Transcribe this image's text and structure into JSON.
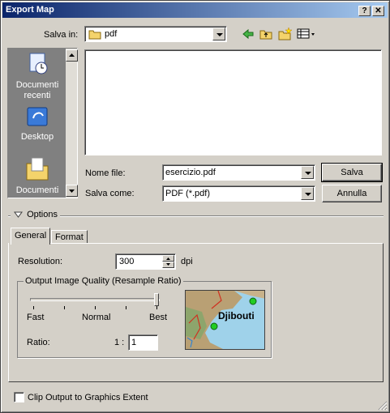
{
  "window": {
    "title": "Export Map",
    "help_glyph": "?",
    "close_glyph": "✕"
  },
  "save_in": {
    "label": "Salva in:",
    "value": "pdf"
  },
  "places": [
    {
      "label": "Documenti recenti",
      "icon": "recent-documents-icon"
    },
    {
      "label": "Desktop",
      "icon": "desktop-icon"
    },
    {
      "label": "Documenti",
      "icon": "documents-folder-icon"
    }
  ],
  "filename": {
    "label": "Nome file:",
    "value": "esercizio.pdf"
  },
  "save_as": {
    "label": "Salva come:",
    "value": "PDF (*.pdf)"
  },
  "buttons": {
    "save": "Salva",
    "cancel": "Annulla"
  },
  "options": {
    "label": "Options"
  },
  "tabs": [
    "General",
    "Format"
  ],
  "resolution": {
    "label": "Resolution:",
    "value": "300",
    "unit": "dpi"
  },
  "quality": {
    "group_label": "Output Image Quality (Resample Ratio)",
    "ticks": [
      "Fast",
      "Normal",
      "Best"
    ],
    "slider_level": 1.0,
    "ratio_label": "Ratio:",
    "ratio_prefix": "1 :",
    "ratio_value": "1",
    "preview_label": "Djibouti"
  },
  "clip": {
    "label": "Clip Output to Graphics Extent",
    "checked": false
  }
}
